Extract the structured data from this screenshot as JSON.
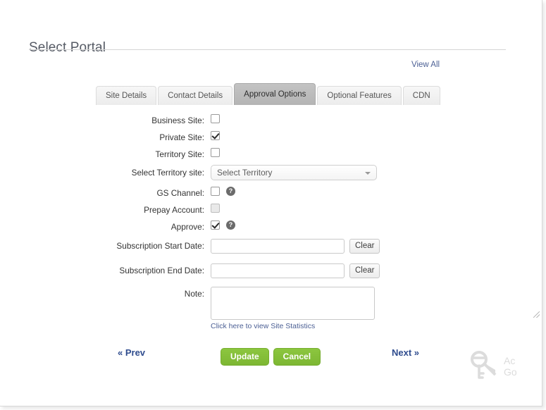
{
  "page": {
    "title": "Select Portal",
    "view_all_label": "View All"
  },
  "tabs": [
    {
      "label": "Site Details",
      "active": false
    },
    {
      "label": "Contact Details",
      "active": false
    },
    {
      "label": "Approval Options",
      "active": true
    },
    {
      "label": "Optional Features",
      "active": false
    },
    {
      "label": "CDN",
      "active": false
    }
  ],
  "form": {
    "business_site": {
      "label": "Business Site:",
      "checked": false,
      "disabled": false
    },
    "private_site": {
      "label": "Private Site:",
      "checked": true,
      "disabled": false
    },
    "territory_site": {
      "label": "Territory Site:",
      "checked": false,
      "disabled": false
    },
    "select_territory": {
      "label": "Select Territory site:",
      "value": "Select Territory",
      "options": [
        "Select Territory"
      ]
    },
    "gs_channel": {
      "label": "GS Channel:",
      "checked": false,
      "disabled": false,
      "help": "?"
    },
    "prepay_account": {
      "label": "Prepay Account:",
      "checked": false,
      "disabled": true
    },
    "approve": {
      "label": "Approve:",
      "checked": true,
      "disabled": false,
      "help": "?"
    },
    "subscription_start": {
      "label": "Subscription Start Date:",
      "value": "",
      "placeholder": "",
      "clear_label": "Clear"
    },
    "subscription_end": {
      "label": "Subscription End Date:",
      "value": "",
      "placeholder": "",
      "clear_label": "Clear"
    },
    "note": {
      "label": "Note:",
      "value": "",
      "placeholder": ""
    },
    "stats_link": "Click here to view Site Statistics"
  },
  "footer": {
    "prev_label": "« Prev",
    "next_label": "Next »",
    "update_label": "Update",
    "cancel_label": "Cancel"
  },
  "watermark": {
    "line1": "Ac",
    "line2": "Go"
  },
  "colors": {
    "accent_green": "#8cc63f",
    "link_blue": "#4b5f94",
    "nav_blue": "#2f4c8e",
    "active_tab": "#b9b9b9"
  }
}
